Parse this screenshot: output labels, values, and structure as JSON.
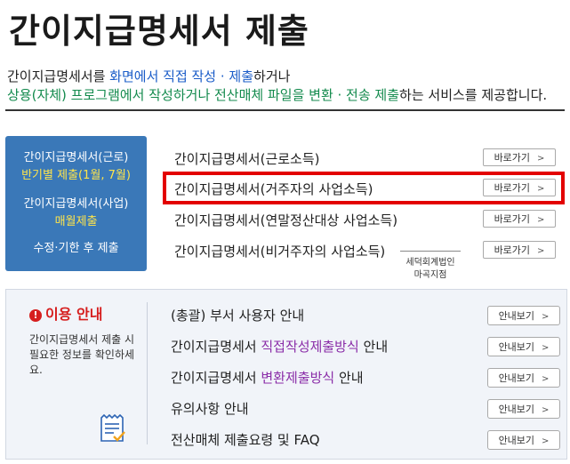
{
  "title": "간이지급명세서 제출",
  "intro": {
    "line1": {
      "part1": "간이지급명세서를 ",
      "part2": "화면에서 직접 작성 · 제출",
      "part3": "하거나"
    },
    "line2": {
      "part1": "상용(자체) 프로그램에서 작성하거나 전산매체 파일을 변환 · 전송 제출",
      "part2": "하는 서비스를 제공합니다."
    }
  },
  "sidebar": {
    "line1": "간이지급명세서(근로)",
    "line1_sub": "반기별 제출(1월, 7월)",
    "line2": "간이지급명세서(사업)",
    "line2_sub": "매월제출",
    "line3": "수정·기한 후 제출"
  },
  "links": [
    {
      "label": "간이지급명세서(근로소득)",
      "button": "바로가기"
    },
    {
      "label": "간이지급명세서(거주자의 사업소득)",
      "button": "바로가기"
    },
    {
      "label": "간이지급명세서(연말정산대상 사업소득)",
      "button": "바로가기"
    },
    {
      "label": "간이지급명세서(비거주자의 사업소득)",
      "button": "바로가기"
    }
  ],
  "stamp": {
    "line1": "세덕회계법인",
    "line2": "마곡지점"
  },
  "info": {
    "heading": "이용 안내",
    "desc": "간이지급명세서 제출 시 필요한 정보를 확인하세요.",
    "items": [
      {
        "label": "(총괄) 부서 사용자 안내",
        "button": "안내보기"
      },
      {
        "label_a": "간이지급명세서 ",
        "label_b": "직접작성제출방식",
        "label_c": " 안내",
        "button": "안내보기"
      },
      {
        "label_a": "간이지급명세서 ",
        "label_b": "변환제출방식",
        "label_c": " 안내",
        "button": "안내보기"
      },
      {
        "label": "유의사항 안내",
        "button": "안내보기"
      },
      {
        "label": "전산매체 제출요령 및 FAQ",
        "button": "안내보기"
      }
    ]
  }
}
